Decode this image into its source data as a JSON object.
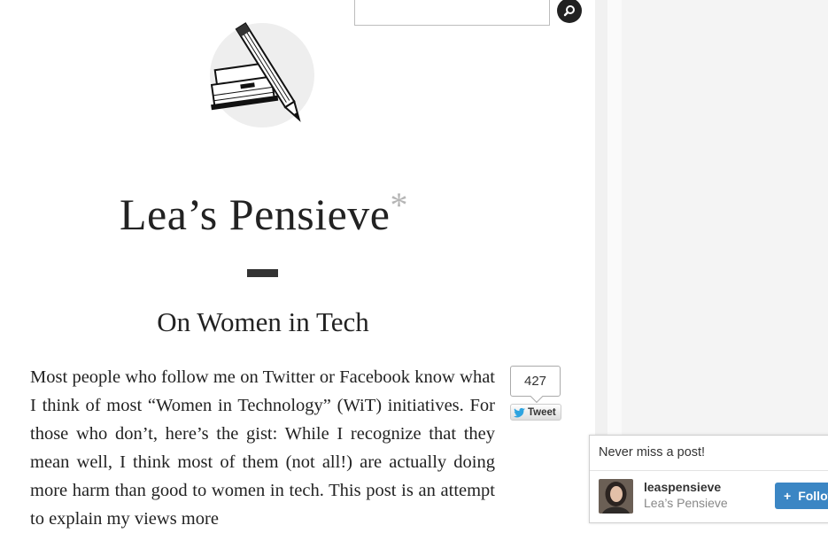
{
  "search": {
    "value": "",
    "placeholder": ""
  },
  "site": {
    "title": "Lea’s Pensieve",
    "title_mark": "*"
  },
  "post": {
    "title": "On Women in Tech",
    "body": "Most people who follow me on Twitter or Facebook know what I think of most “Women in Technology” (WiT) initiatives. For those who don’t, here’s the gist: While I recognize that they mean well, I think most of them (not all!) are actually doing more harm than good to women in tech. This post is an attempt to explain my views more"
  },
  "share": {
    "count": "427",
    "tweet_label": "Tweet",
    "icon": "twitter-bird-icon"
  },
  "follow_widget": {
    "heading": "Never miss a post!",
    "username": "leaspensieve",
    "blog_name": "Lea’s Pensieve",
    "button_label": "Follow",
    "button_color": "#3b86c4"
  },
  "colors": {
    "sidebar": "#f4f4f4",
    "title_mark": "#b5b5b5",
    "text": "#222222"
  }
}
